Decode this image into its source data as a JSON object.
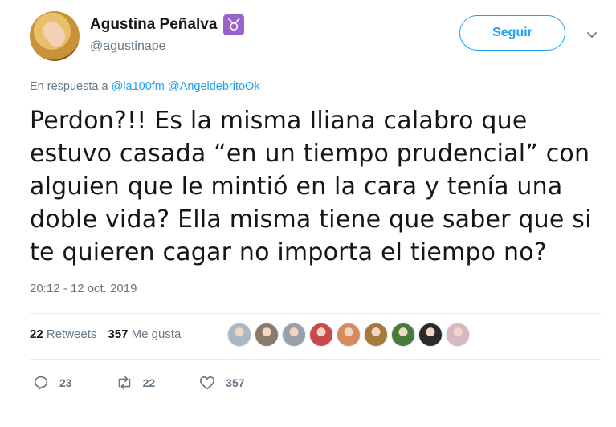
{
  "author": {
    "name": "Agustina Peñalva",
    "zodiac_symbol": "♉",
    "handle": "@agustinape"
  },
  "follow_button": {
    "label": "Seguir"
  },
  "reply_to": {
    "prefix": "En respuesta a",
    "mentions": [
      "@la100fm",
      "@AngeldebritoOk"
    ]
  },
  "tweet": {
    "lines": [
      "Perdon?!! Es la misma Iliana calabro que",
      "estuvo casada “en un tiempo prudencial” con",
      "alguien que le mintió en la cara y tenía una",
      "doble vida? Ella misma tiene que saber que si",
      "te quieren cagar no importa el tiempo no?"
    ],
    "timestamp": "20:12 - 12 oct. 2019"
  },
  "stats": {
    "retweets_count": "22",
    "retweets_label": "Retweets",
    "likes_count": "357",
    "likes_label": "Me gusta"
  },
  "likers": [
    {
      "name": "liker-1",
      "color": "#aab8c2"
    },
    {
      "name": "liker-2",
      "color": "#8a7a6a"
    },
    {
      "name": "liker-3",
      "color": "#9aa0a6"
    },
    {
      "name": "liker-4",
      "color": "#c84a4a"
    },
    {
      "name": "liker-5",
      "color": "#d98a5a"
    },
    {
      "name": "liker-6",
      "color": "#a87a3a"
    },
    {
      "name": "liker-7",
      "color": "#4a7a3a"
    },
    {
      "name": "liker-8",
      "color": "#2a2a2a"
    },
    {
      "name": "liker-9",
      "color": "#d8b8c0"
    }
  ],
  "actions": {
    "reply_count": "23",
    "retweet_count": "22",
    "like_count": "357"
  }
}
